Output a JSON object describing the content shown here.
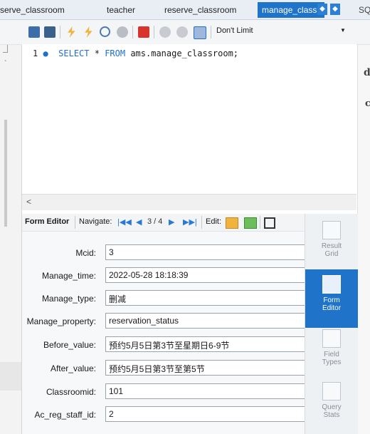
{
  "tabs": {
    "t1": "serve_classroom",
    "t2": "teacher",
    "t3": "reserve_classroom",
    "t4": "manage_class",
    "t5": "SQ"
  },
  "toolbar": {
    "limit_value": "Don't Limit"
  },
  "editor": {
    "line_number": "1",
    "query_kw1": "SELECT",
    "query_mid": " * ",
    "query_kw2": "FROM",
    "query_rest": " ams.manage_classroom;"
  },
  "right_chars": {
    "c1": "d",
    "c2": "c"
  },
  "formbar": {
    "title": "Form Editor",
    "navigate_label": "Navigate:",
    "position": "3 / 4",
    "edit_label": "Edit:"
  },
  "form": {
    "fields": [
      {
        "label": "Mcid:",
        "value": "3"
      },
      {
        "label": "Manage_time:",
        "value": "2022-05-28 18:18:39"
      },
      {
        "label": "Manage_type:",
        "value": "删减"
      },
      {
        "label": "Manage_property:",
        "value": "reservation_status"
      },
      {
        "label": "Before_value:",
        "value": "预约5月5日第3节至星期日6-9节"
      },
      {
        "label": "After_value:",
        "value": "预约5月5日第3节至第5节"
      },
      {
        "label": "Classroomid:",
        "value": "101"
      },
      {
        "label": "Ac_reg_staff_id:",
        "value": "2"
      }
    ]
  },
  "side_panel": {
    "result_grid": "Result Grid",
    "form_editor": "Form Editor",
    "field_types": "Field Types",
    "query_stats": "Query Stats"
  },
  "colors": {
    "accent": "#1f73c9",
    "keyword": "#1f6fd1"
  }
}
